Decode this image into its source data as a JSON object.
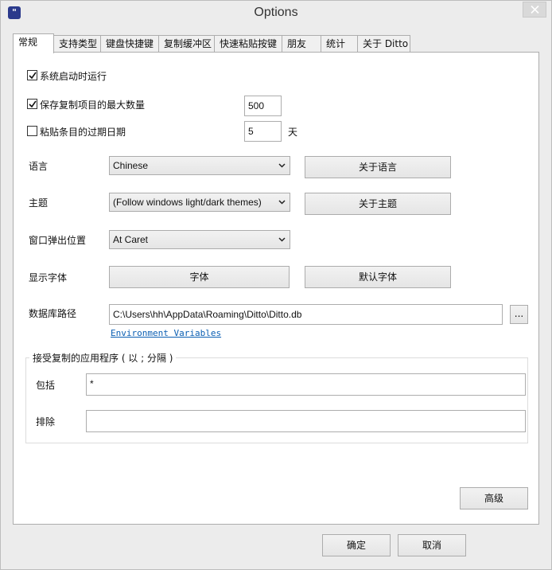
{
  "window": {
    "title": "Options",
    "app_icon_glyph": "\""
  },
  "tabs": [
    {
      "label": "常规",
      "active": true
    },
    {
      "label": "支持类型"
    },
    {
      "label": "键盘快捷键"
    },
    {
      "label": "复制缓冲区"
    },
    {
      "label": "快速粘贴按键"
    },
    {
      "label": "朋友"
    },
    {
      "label": "统计"
    },
    {
      "label": "关于 Ditto"
    }
  ],
  "general": {
    "start_on_boot": {
      "label": "系统启动时运行",
      "checked": true
    },
    "max_items": {
      "label": "保存复制项目的最大数量",
      "checked": true,
      "value": "500"
    },
    "expire": {
      "label": "粘贴条目的过期日期",
      "checked": false,
      "value": "5",
      "unit": "天"
    },
    "language": {
      "label": "语言",
      "value": "Chinese",
      "about_button": "关于语言"
    },
    "theme": {
      "label": "主题",
      "value": "(Follow windows light/dark themes)",
      "about_button": "关于主题"
    },
    "popup_position": {
      "label": "窗口弹出位置",
      "value": "At Caret"
    },
    "font": {
      "label": "显示字体",
      "font_button": "字体",
      "default_button": "默认字体"
    },
    "database": {
      "label": "数据库路径",
      "value": "C:\\Users\\hh\\AppData\\Roaming\\Ditto\\Ditto.db",
      "browse_button": "...",
      "env_link": "Environment Variables"
    },
    "accept_apps": {
      "title": "接受复制的应用程序 ( 以 ; 分隔 )",
      "include_label": "包括",
      "include_value": "*",
      "exclude_label": "排除",
      "exclude_value": ""
    },
    "advanced_button": "高级"
  },
  "footer": {
    "ok_button": "确定",
    "cancel_button": "取消"
  },
  "colors": {
    "link": "#0b5fb3",
    "app_icon": "#2b3a8c",
    "panel_bg": "#ffffff",
    "window_bg": "#ececec"
  }
}
